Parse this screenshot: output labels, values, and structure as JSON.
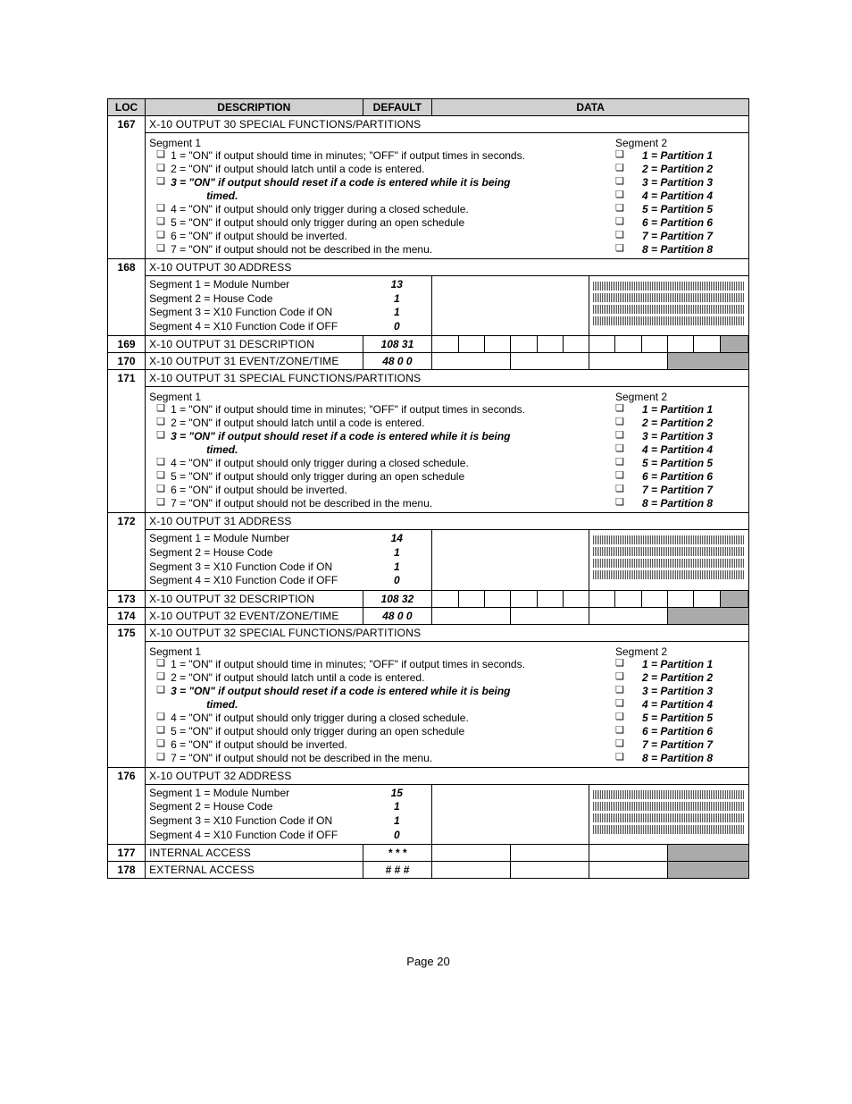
{
  "headers": {
    "loc": "LOC",
    "description": "DESCRIPTION",
    "default": "DEFAULT",
    "data": "DATA"
  },
  "segment1_title": "Segment 1",
  "segment2_title": "Segment 2",
  "seg1_options": {
    "opt1": "1 = \"ON\" if output should time in minutes;  \"OFF\" if output times in seconds.",
    "opt2": "2 = \"ON\" if output should latch until a code is entered.",
    "opt3_pre": "3 = \"ON\" if output should reset if a code is entered while it is being",
    "opt3_timed": "timed.",
    "opt4": "4 = \"ON\" if output should only trigger during a closed schedule.",
    "opt5": "5 = \"ON\" if output should only trigger during an open schedule",
    "opt6": "6 = \"ON\" if output should be inverted.",
    "opt7": "7 = \"ON\" if output should not be described in the menu."
  },
  "partitions": {
    "p1": "1 = Partition 1",
    "p2": "2 = Partition 2",
    "p3": "3 = Partition 3",
    "p4": "4 = Partition 4",
    "p5": "5 = Partition 5",
    "p6": "6 = Partition 6",
    "p7": "7 = Partition 7",
    "p8": "8 = Partition 8"
  },
  "addr_labels": {
    "s1": "Segment 1 = Module Number",
    "s2": "Segment 2 = House Code",
    "s3": "Segment 3 = X10 Function Code if ON",
    "s4": "Segment 4 = X10 Function Code if OFF"
  },
  "rows": {
    "r167": {
      "loc": "167",
      "title": "X-10 OUTPUT 30 SPECIAL FUNCTIONS/PARTITIONS"
    },
    "r168": {
      "loc": "168",
      "title": "X-10 OUTPUT 30  ADDRESS",
      "mod": "13",
      "house": "1",
      "on": "1",
      "off": "0"
    },
    "r169": {
      "loc": "169",
      "title": "X-10 OUTPUT 31 DESCRIPTION",
      "default": "108 31"
    },
    "r170": {
      "loc": "170",
      "title": "X-10 OUTPUT 31 EVENT/ZONE/TIME",
      "default": "48 0 0"
    },
    "r171": {
      "loc": "171",
      "title": "X-10 OUTPUT 31 SPECIAL FUNCTIONS/PARTITIONS"
    },
    "r172": {
      "loc": "172",
      "title": "X-10 OUTPUT 31  ADDRESS",
      "mod": "14",
      "house": "1",
      "on": "1",
      "off": "0"
    },
    "r173": {
      "loc": "173",
      "title": "X-10 OUTPUT 32 DESCRIPTION",
      "default": "108 32"
    },
    "r174": {
      "loc": "174",
      "title": "X-10 OUTPUT 32 EVENT/ZONE/TIME",
      "default": "48 0 0"
    },
    "r175": {
      "loc": "175",
      "title": "X-10 OUTPUT 32 SPECIAL FUNCTIONS/PARTITIONS"
    },
    "r176": {
      "loc": "176",
      "title": "X-10 OUTPUT 32  ADDRESS",
      "mod": "15",
      "house": "1",
      "on": "1",
      "off": "0"
    },
    "r177": {
      "loc": "177",
      "title": "INTERNAL ACCESS",
      "default": "* * *"
    },
    "r178": {
      "loc": "178",
      "title": "EXTERNAL ACCESS",
      "default": "# # #"
    }
  },
  "footer": "Page 20"
}
